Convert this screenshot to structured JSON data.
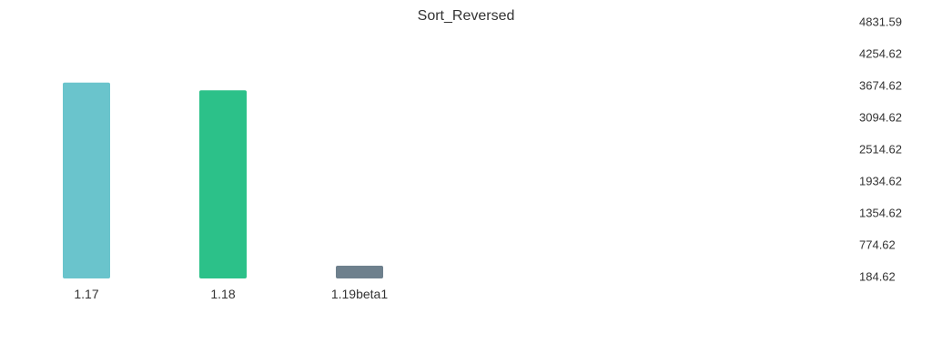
{
  "chart_data": {
    "type": "bar",
    "title": "Sort_Reversed",
    "xlabel": "",
    "ylabel": "",
    "categories": [
      "1.17",
      "1.18",
      "1.19beta1"
    ],
    "values": [
      3740,
      3600,
      400
    ],
    "colors": [
      "#6ac4cc",
      "#2cc189",
      "#6e808d"
    ],
    "yticks": [
      "184.62",
      "774.62",
      "1354.62",
      "1934.62",
      "2514.62",
      "3094.62",
      "3674.62",
      "4254.62",
      "4831.59"
    ],
    "ylim": [
      184.62,
      4831.59
    ],
    "y_axis_position": "right",
    "grid": false,
    "legend": "none"
  }
}
